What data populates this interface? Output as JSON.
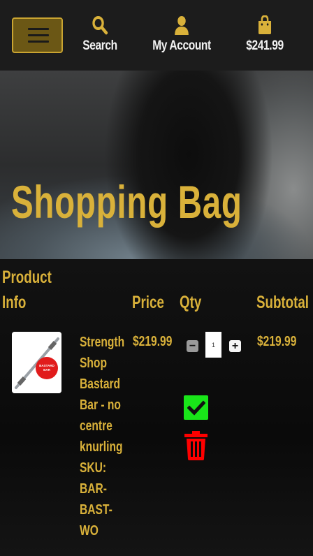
{
  "header": {
    "menu_icon": "hamburger-icon",
    "search": {
      "label": "Search",
      "icon": "search-icon"
    },
    "account": {
      "label": "My Account",
      "icon": "user-icon"
    },
    "bag": {
      "label": "$241.99",
      "icon": "shopping-bag-icon"
    }
  },
  "hero": {
    "title": "Shopping Bag"
  },
  "table": {
    "headers": {
      "product_info": "Product Info",
      "price": "Price",
      "qty": "Qty",
      "subtotal": "Subtotal"
    }
  },
  "items": [
    {
      "name_lines": [
        "Strength",
        "Shop",
        "Bastard",
        "Bar - no",
        "centre",
        "knurling",
        "SKU:",
        "BAR-",
        "BAST-WO"
      ],
      "image_label": "BASTARD BAR",
      "price": "$219.99",
      "quantity": "1",
      "subtotal": "$219.99"
    }
  ],
  "colors": {
    "gold": "#d9b13a",
    "header_bg": "#1c1c1c",
    "update_green": "#19e619",
    "delete_red": "#ff0000"
  }
}
